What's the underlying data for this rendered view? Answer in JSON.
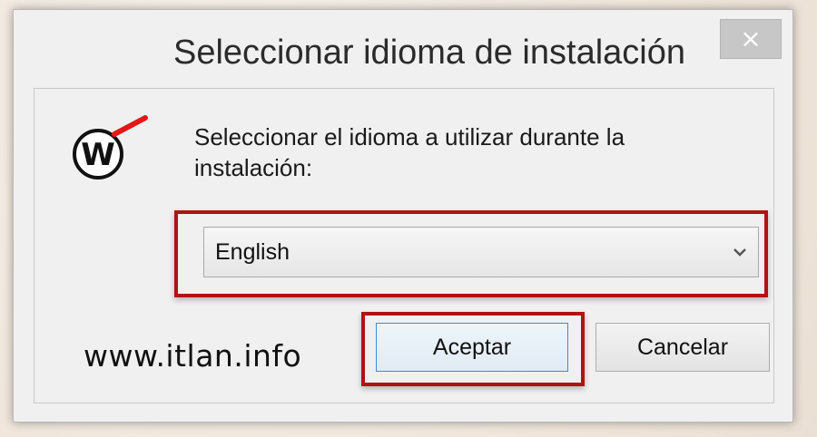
{
  "dialog": {
    "title": "Seleccionar idioma de instalación",
    "close_symbol": "×",
    "prompt": "Seleccionar el idioma a utilizar durante la instalación:",
    "language_select": {
      "value": "English"
    },
    "accept_label": "Aceptar",
    "cancel_label": "Cancelar",
    "watermark": "www.itlan.info"
  },
  "icons": [
    "watchguard-logo-icon",
    "chevron-down-icon"
  ],
  "colors": {
    "highlight": "#b01212",
    "focus_border": "#3c8ad6",
    "close_bg": "#c7c7c7"
  }
}
